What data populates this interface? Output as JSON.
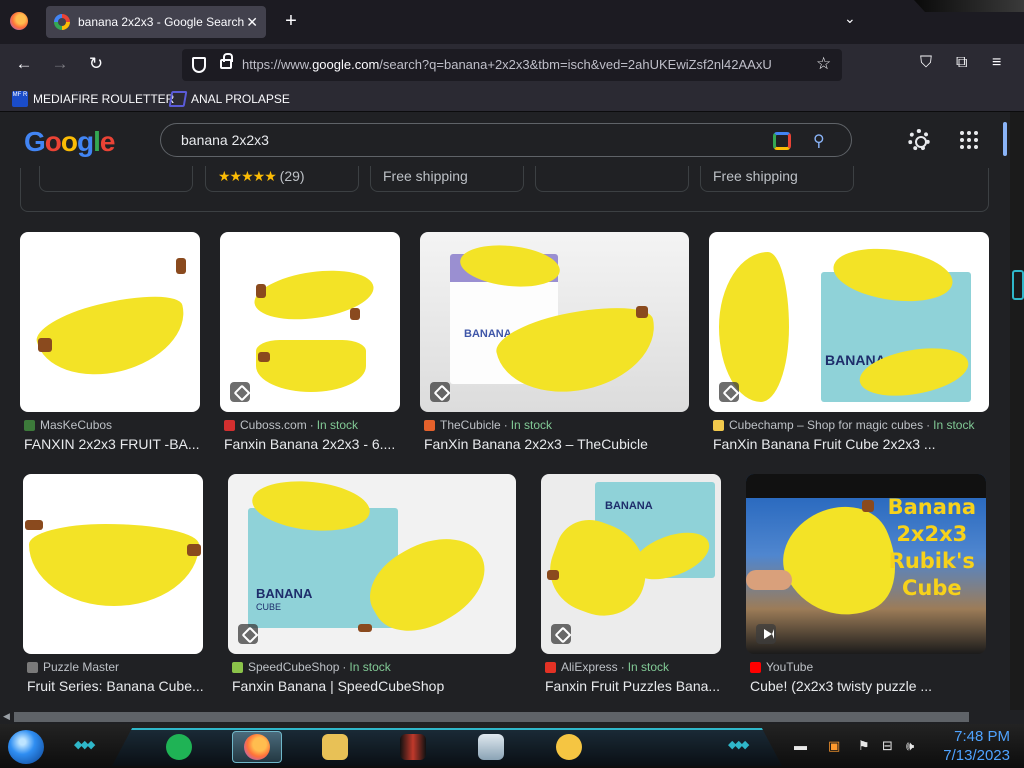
{
  "browser": {
    "tab_title": "banana 2x2x3 - Google Search",
    "tab_close": "✕",
    "new_tab": "+",
    "tab_list": "⌄",
    "url_prefix": "https://www.",
    "url_domain": "google.com",
    "url_rest": "/search?q=banana+2x2x3&tbm=isch&ved=2ahUKEwiZsf2nl42AAxU",
    "back": "←",
    "forward": "→",
    "reload": "↻",
    "star": "☆",
    "pocket": "⛉",
    "extensions": "⧉",
    "menu": "≡"
  },
  "bookmarks": [
    {
      "label": "MEDIAFIRE ROULETTER",
      "icon_text": "MF R"
    },
    {
      "label": "ANAL PROLAPSE"
    }
  ],
  "google": {
    "logo": [
      "G",
      "o",
      "o",
      "g",
      "l",
      "e"
    ],
    "query": "banana 2x2x3",
    "search_icon": "⚲"
  },
  "shopping": {
    "rating_stars": "★★★★★",
    "rating_count": "(29)",
    "shipping_1": "Free shipping",
    "shipping_2": "Free shipping"
  },
  "results": [
    {
      "source": "MasKeCubos",
      "stock": "",
      "caption": "FANXIN 2x2x3 FRUIT -BA...",
      "fav_color": "#3c7a3a",
      "tag": false
    },
    {
      "source": "Cuboss.com",
      "stock": "In stock",
      "caption": "Fanxin Banana 2x2x3 - 6....",
      "fav_color": "#d32f2f",
      "tag": true
    },
    {
      "source": "TheCubicle",
      "stock": "In stock",
      "caption": "FanXin Banana 2x2x3 – TheCubicle",
      "fav_color": "#e5612b",
      "tag": true
    },
    {
      "source": "Cubechamp – Shop for magic cubes",
      "stock": "In stock",
      "caption": "FanXin Banana Fruit Cube 2x2x3 ...",
      "fav_color": "#f2c94c",
      "tag": true
    },
    {
      "source": "Puzzle Master",
      "stock": "",
      "caption": "Fruit Series: Banana Cube...",
      "fav_color": "#7a7a7a",
      "tag": false
    },
    {
      "source": "SpeedCubeShop",
      "stock": "In stock",
      "caption": "Fanxin Banana | SpeedCubeShop",
      "fav_color": "#8bc34a",
      "tag": true
    },
    {
      "source": "AliExpress",
      "stock": "In stock",
      "caption": "Fanxin Fruit Puzzles Bana...",
      "fav_color": "#e43225",
      "tag": true
    },
    {
      "source": "YouTube",
      "stock": "",
      "caption": "Cube! (2x2x3 twisty puzzle ...",
      "fav_color": "#ff0000",
      "tag": false
    }
  ],
  "stock_sep": "·",
  "thumb_text": {
    "banana_label": "BANANA",
    "banana_sub": "CUBE",
    "yt_line1": "Banana",
    "yt_line2": "2x2x3",
    "yt_line3": "Rubik's",
    "yt_line4": "Cube"
  },
  "taskbar": {
    "time": "7:48 PM",
    "date": "7/13/2023",
    "chevrons": "◆◆◆"
  }
}
